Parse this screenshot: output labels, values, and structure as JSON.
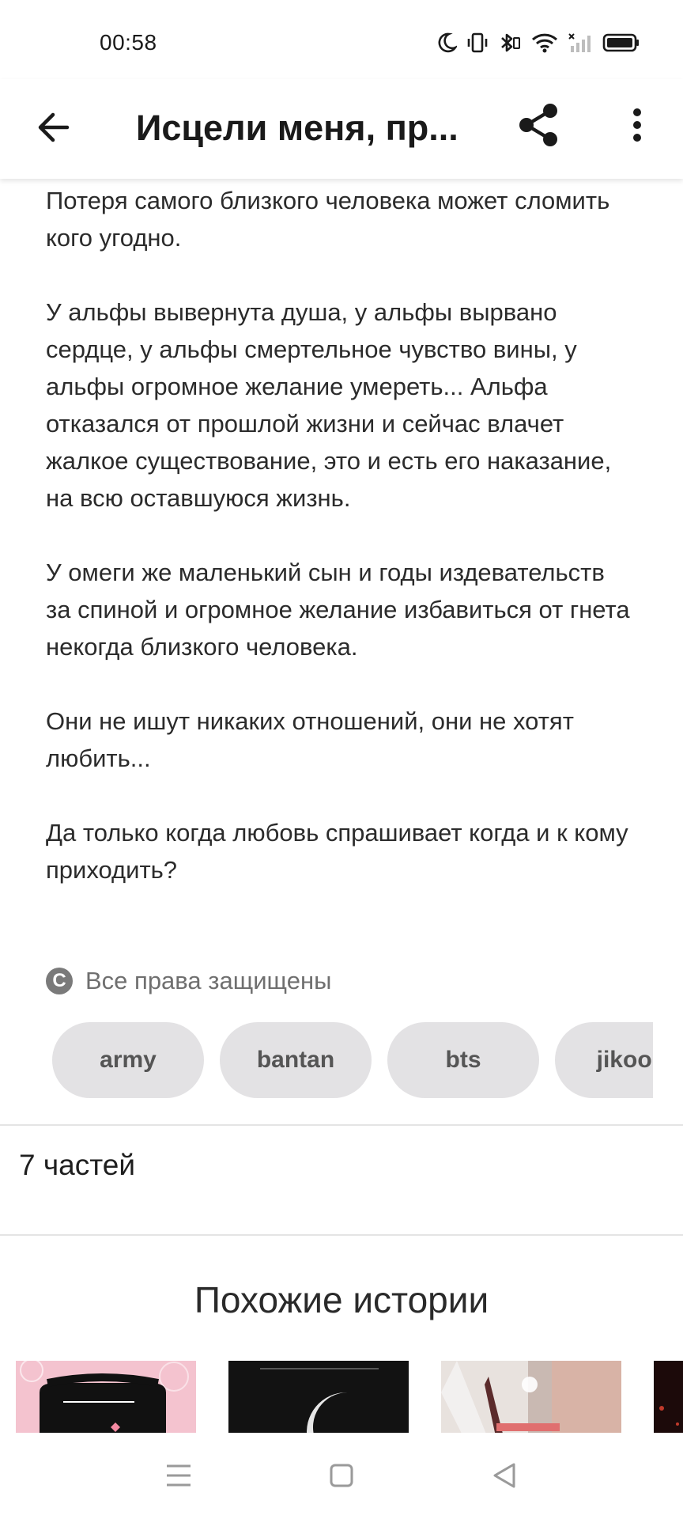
{
  "status_bar": {
    "time": "00:58",
    "icons": [
      "moon-icon",
      "vibrate-icon",
      "bluetooth-icon",
      "wifi-icon",
      "signal-icon",
      "battery-icon"
    ]
  },
  "app_bar": {
    "back_icon": "arrow-left-icon",
    "title": "Исцели меня, пр...",
    "share_icon": "share-icon",
    "more_icon": "more-vert-icon"
  },
  "description": {
    "paragraphs": [
      "Потеря самого близкого человека может сломить кого угодно.",
      "У альфы вывернута душа, у альфы вырвано сердце, у альфы смертельное чувство вины, у альфы огромное желание умереть... Альфа отказался от прошлой жизни и сейчас влачет жалкое существование, это и есть его наказание, на всю оставшуюся жизнь.",
      "У омеги же маленький сын и годы издевательств за спиной и огромное желание избавиться от гнета некогда близкого человека.",
      "Они не ишут никаких отношений, они не хотят любить...",
      "Да только когда любовь спрашивает когда и к кому приходить?"
    ]
  },
  "copyright": {
    "icon_glyph": "C",
    "label": "Все права защищены"
  },
  "tags": [
    "army",
    "bantan",
    "bts",
    "jikook"
  ],
  "parts": {
    "label": "7 частей"
  },
  "similar": {
    "title": "Похожие истории",
    "covers": [
      {
        "name": "cover-1",
        "color": "#f4c3cf"
      },
      {
        "name": "cover-2",
        "color": "#121212"
      },
      {
        "name": "cover-3",
        "color": "#c9b9b2"
      },
      {
        "name": "cover-4",
        "color": "#1c0a0a"
      }
    ]
  },
  "nav_bar": {
    "icons": [
      "menu-icon",
      "home-square-icon",
      "back-triangle-icon"
    ]
  },
  "colors": {
    "tag_bg": "#e3e2e4",
    "divider": "#e4e4e4",
    "text": "#2b2b2b"
  }
}
